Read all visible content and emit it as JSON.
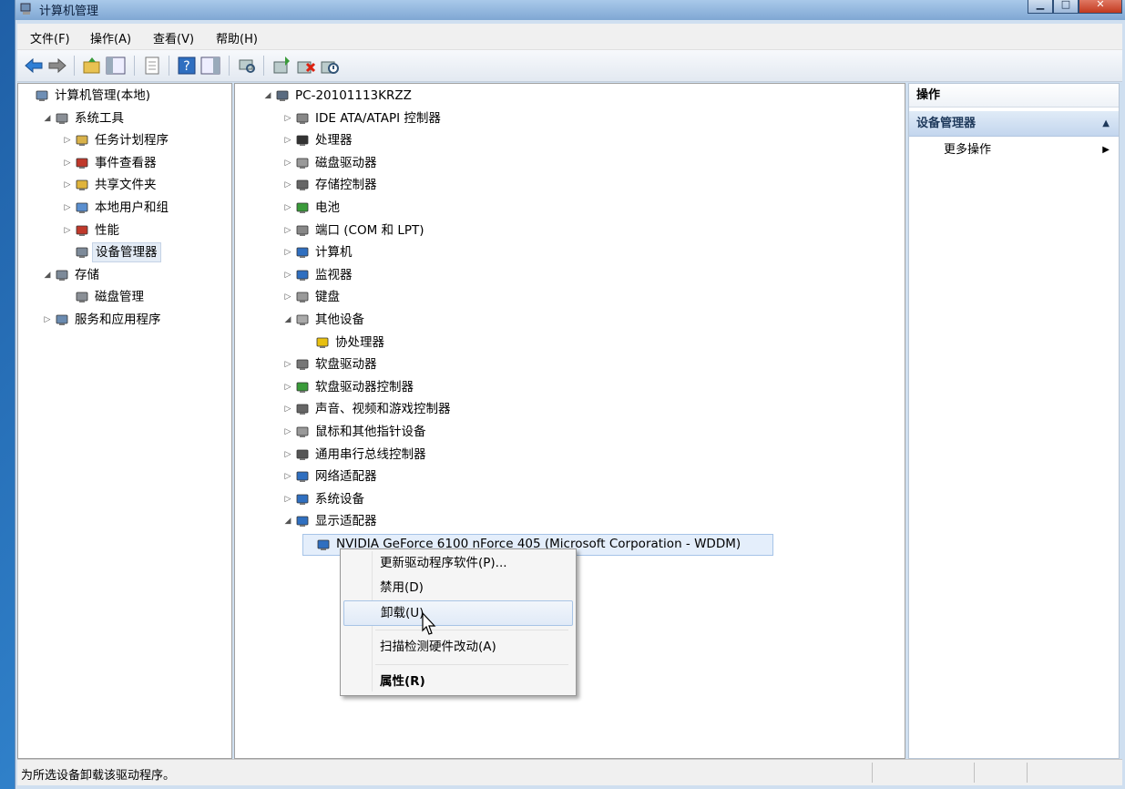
{
  "window": {
    "title": "计算机管理"
  },
  "menubar": [
    {
      "label": "文件(F)"
    },
    {
      "label": "操作(A)"
    },
    {
      "label": "查看(V)"
    },
    {
      "label": "帮助(H)"
    }
  ],
  "toolbar": {
    "icons": [
      "back-icon",
      "forward-icon",
      "up-folder-icon",
      "show-console-tree-icon",
      "export-list-icon",
      "help-icon",
      "show-action-pane-icon",
      "scan-hardware-icon",
      "update-driver-icon",
      "uninstall-device-icon",
      "disable-device-icon"
    ]
  },
  "left_tree": [
    {
      "label": "计算机管理(本地)",
      "level": 0,
      "expander": "",
      "icon": "computer-management-icon"
    },
    {
      "label": "系统工具",
      "level": 1,
      "expander": "◢",
      "icon": "system-tools-icon"
    },
    {
      "label": "任务计划程序",
      "level": 2,
      "expander": "▷",
      "icon": "task-scheduler-icon"
    },
    {
      "label": "事件查看器",
      "level": 2,
      "expander": "▷",
      "icon": "event-viewer-icon"
    },
    {
      "label": "共享文件夹",
      "level": 2,
      "expander": "▷",
      "icon": "shared-folders-icon"
    },
    {
      "label": "本地用户和组",
      "level": 2,
      "expander": "▷",
      "icon": "local-users-icon"
    },
    {
      "label": "性能",
      "level": 2,
      "expander": "▷",
      "icon": "performance-icon"
    },
    {
      "label": "设备管理器",
      "level": 2,
      "expander": "",
      "icon": "device-manager-icon",
      "selected": true
    },
    {
      "label": "存储",
      "level": 1,
      "expander": "◢",
      "icon": "storage-icon"
    },
    {
      "label": "磁盘管理",
      "level": 2,
      "expander": "",
      "icon": "disk-management-icon"
    },
    {
      "label": "服务和应用程序",
      "level": 1,
      "expander": "▷",
      "icon": "services-apps-icon"
    }
  ],
  "device_tree": [
    {
      "label": "PC-20101113KRZZ",
      "level": 0,
      "expander": "◢",
      "icon": "computer-icon"
    },
    {
      "label": "IDE ATA/ATAPI 控制器",
      "level": 1,
      "expander": "▷",
      "icon": "ide-controller-icon"
    },
    {
      "label": "处理器",
      "level": 1,
      "expander": "▷",
      "icon": "processor-icon"
    },
    {
      "label": "磁盘驱动器",
      "level": 1,
      "expander": "▷",
      "icon": "disk-drive-icon"
    },
    {
      "label": "存储控制器",
      "level": 1,
      "expander": "▷",
      "icon": "storage-controller-icon"
    },
    {
      "label": "电池",
      "level": 1,
      "expander": "▷",
      "icon": "battery-icon"
    },
    {
      "label": "端口 (COM 和 LPT)",
      "level": 1,
      "expander": "▷",
      "icon": "port-icon"
    },
    {
      "label": "计算机",
      "level": 1,
      "expander": "▷",
      "icon": "computer-node-icon"
    },
    {
      "label": "监视器",
      "level": 1,
      "expander": "▷",
      "icon": "monitor-icon"
    },
    {
      "label": "键盘",
      "level": 1,
      "expander": "▷",
      "icon": "keyboard-icon"
    },
    {
      "label": "其他设备",
      "level": 1,
      "expander": "◢",
      "icon": "other-devices-icon"
    },
    {
      "label": "协处理器",
      "level": 2,
      "expander": "",
      "icon": "coprocessor-warning-icon"
    },
    {
      "label": "软盘驱动器",
      "level": 1,
      "expander": "▷",
      "icon": "floppy-drive-icon"
    },
    {
      "label": "软盘驱动器控制器",
      "level": 1,
      "expander": "▷",
      "icon": "floppy-controller-icon"
    },
    {
      "label": "声音、视频和游戏控制器",
      "level": 1,
      "expander": "▷",
      "icon": "sound-icon"
    },
    {
      "label": "鼠标和其他指针设备",
      "level": 1,
      "expander": "▷",
      "icon": "mouse-icon"
    },
    {
      "label": "通用串行总线控制器",
      "level": 1,
      "expander": "▷",
      "icon": "usb-icon"
    },
    {
      "label": "网络适配器",
      "level": 1,
      "expander": "▷",
      "icon": "network-adapter-icon"
    },
    {
      "label": "系统设备",
      "level": 1,
      "expander": "▷",
      "icon": "system-devices-icon"
    },
    {
      "label": "显示适配器",
      "level": 1,
      "expander": "◢",
      "icon": "display-adapter-icon"
    },
    {
      "label": "NVIDIA GeForce 6100 nForce 405 (Microsoft Corporation - WDDM)",
      "level": 2,
      "expander": "",
      "icon": "gpu-icon",
      "selected": true
    }
  ],
  "context_menu": [
    {
      "label": "更新驱动程序软件(P)..."
    },
    {
      "label": "禁用(D)"
    },
    {
      "label": "卸载(U)",
      "hover": true
    },
    {
      "separator": true
    },
    {
      "label": "扫描检测硬件改动(A)"
    },
    {
      "separator": true
    },
    {
      "label": "属性(R)",
      "bold": true
    }
  ],
  "actions": {
    "header": "操作",
    "section": "设备管理器",
    "more": "更多操作"
  },
  "status": {
    "text": "为所选设备卸载该驱动程序。"
  },
  "colors": {
    "selection": "#e4eefb",
    "section_blue": "#c3d6ee"
  }
}
